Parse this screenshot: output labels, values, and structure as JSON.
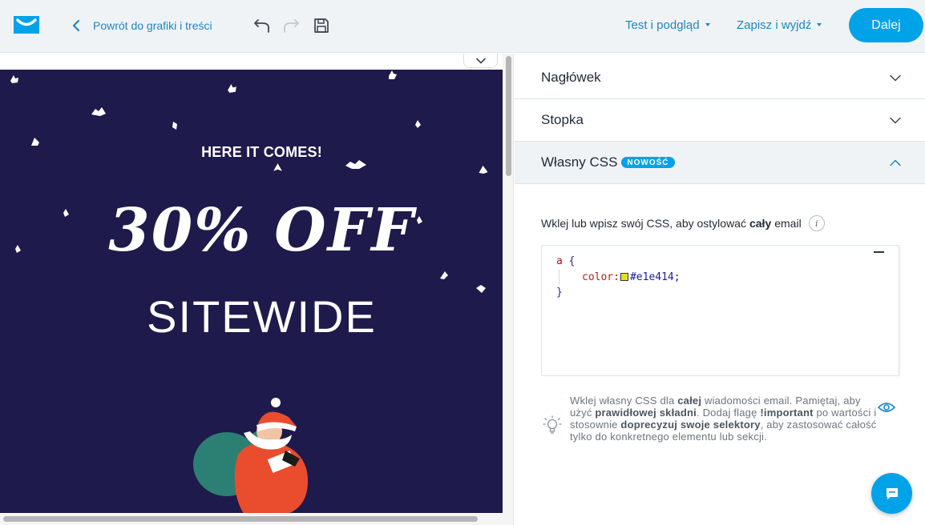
{
  "topbar": {
    "back_label": "Powrót do grafiki i treści",
    "test_preview_label": "Test i podgląd",
    "save_exit_label": "Zapisz i wyjdź",
    "next_label": "Dalej",
    "icons": [
      "logo-icon",
      "chevron-left-icon",
      "undo-icon",
      "redo-icon",
      "save-icon",
      "caret-down-icon"
    ]
  },
  "email": {
    "kicker": "HERE IT COMES!",
    "headline": "30% OFF",
    "subheadline": "SITEWIDE",
    "background": "#1f1a4c"
  },
  "panel": {
    "sections": [
      {
        "title": "Nagłówek",
        "expanded": false
      },
      {
        "title": "Stopka",
        "expanded": false
      },
      {
        "title": "Własny CSS",
        "badge": "NOWOŚĆ",
        "expanded": true
      }
    ],
    "css_label_pre": "Wklej lub wpisz swój CSS, aby ostylować",
    "css_label_bold": "cały",
    "css_label_post": "email",
    "code": {
      "selector": "a",
      "open_brace": "{",
      "property": "color:",
      "value": "#e1e414;",
      "swatch_color": "#e1e414",
      "close_brace": "}"
    },
    "tip": {
      "p1": "Wklej własny CSS dla ",
      "b1": "całej",
      "p2": " wiadomości email. Pamiętaj, aby użyć ",
      "b2": "prawidłowej składni",
      "p3": ". Dodaj flagę ",
      "b3": "!important",
      "p4": " po wartości i stosownie ",
      "b4": "doprecyzuj swoje selektory",
      "p5": ", aby zastosować całość tylko do konkretnego elementu lub sekcji."
    }
  },
  "colors": {
    "accent": "#00a2e8",
    "link": "#1b86c8",
    "topbar_bg": "#f0f3f6"
  }
}
